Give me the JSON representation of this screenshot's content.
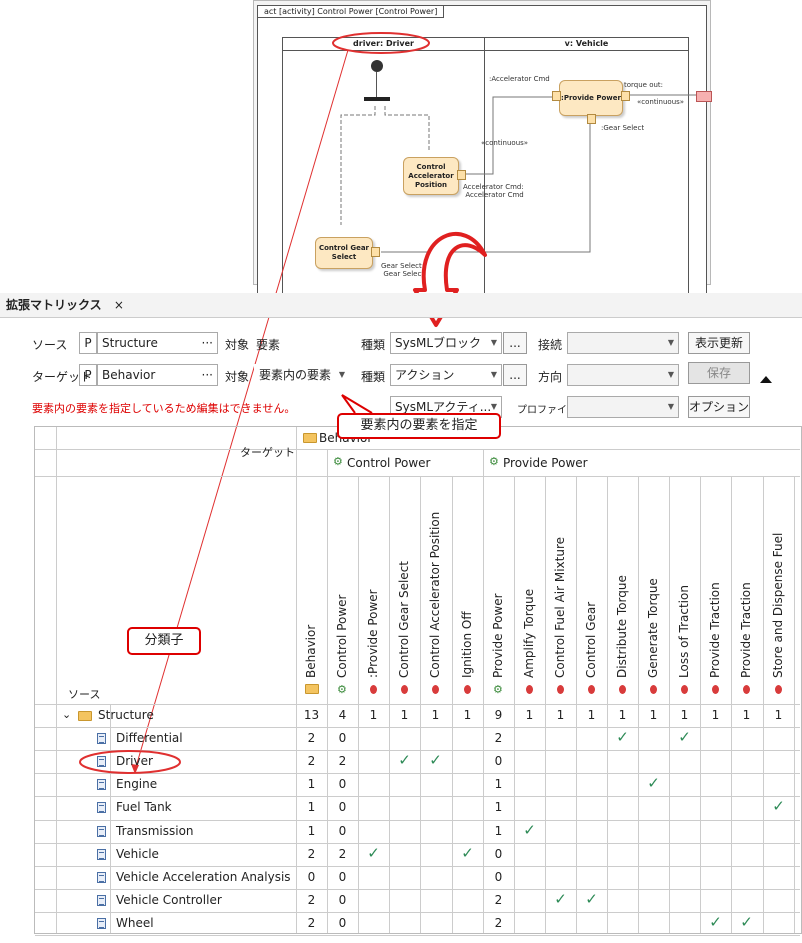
{
  "diagram": {
    "title": "act [activity] Control Power [Control Power]",
    "lane1": "driver: Driver",
    "lane2": "v: Vehicle",
    "actions": {
      "provide_power": ":Provide Power",
      "control_accel": "Control Accelerator Position",
      "control_gear": "Control Gear Select"
    },
    "labels": {
      "accel_cmd_top": ":Accelerator Cmd",
      "torque_out": "torque out:",
      "continuous1": "«continuous»",
      "continuous2": "«continuous»",
      "gear_select": ":Gear Select",
      "accel_cmd_pair": "Accelerator Cmd:\nAccelerator Cmd",
      "gear_select_pair": "Gear Select:\nGear Select"
    }
  },
  "tab": {
    "title": "拡張マトリックス",
    "close": "×"
  },
  "toolbar": {
    "source_label": "ソース",
    "source_p": "P",
    "source_value": "Structure",
    "source_dots": "···",
    "source_target_label": "対象",
    "source_target_value": "要素",
    "source_kind_label": "種類",
    "source_kind_value": "SysMLブロック",
    "source_kind_more": "...",
    "connect_label": "接続",
    "connect_value": "",
    "refresh_button": "表示更新",
    "target_label": "ターゲット",
    "target_p": "P",
    "target_value": "Behavior",
    "target_dots": "···",
    "target_target_label": "対象",
    "target_target_value": "要素内の要素",
    "target_kind_label": "種類",
    "target_kind_value": "アクション",
    "target_kind_more": "...",
    "direction_label": "方向",
    "direction_value": "",
    "save_button": "保存",
    "warning": "要素内の要素を指定しているため編集はできません。",
    "kind2_value": "SysMLアクティ...",
    "profile_label": "プロファイル",
    "profile_value": "",
    "options_button": "オプション"
  },
  "callouts": {
    "specify_inner": "要素内の要素を指定",
    "classifier": "分類子"
  },
  "matrix": {
    "target_header": "ターゲット",
    "source_header": "ソース",
    "behavior_group": "Behavior",
    "groups": [
      "Control Power",
      "Provide Power"
    ],
    "columns": [
      "Behavior",
      "Control Power",
      ":Provide Power",
      "Control  Gear Select",
      "Control Accelerator Position",
      "Ignition Off",
      "Provide Power",
      "Amplify Torque",
      "Control Fuel Air Mixture",
      "Control Gear",
      "Distribute Torque",
      "Generate Torque",
      "Loss of Traction",
      "Provide Traction",
      "Provide Traction",
      "Store and Dispense Fuel"
    ],
    "column_icons": [
      "folder",
      "activity",
      "action",
      "action",
      "action",
      "action",
      "activity",
      "action",
      "action",
      "action",
      "action",
      "action",
      "action",
      "action",
      "action",
      "action"
    ],
    "rows": [
      {
        "label": "Structure",
        "icon": "folder",
        "expanded": "⌄",
        "cells": [
          "13",
          "4",
          "1",
          "1",
          "1",
          "1",
          "9",
          "1",
          "1",
          "1",
          "1",
          "1",
          "1",
          "1",
          "1",
          "1"
        ]
      },
      {
        "label": "Differential",
        "icon": "block",
        "cells": [
          "2",
          "0",
          "",
          "",
          "",
          "",
          "2",
          "",
          "",
          "",
          "✓",
          "",
          "✓",
          "",
          "",
          ""
        ]
      },
      {
        "label": "Driver",
        "icon": "block",
        "cells": [
          "2",
          "2",
          "",
          "✓",
          "✓",
          "",
          "0",
          "",
          "",
          "",
          "",
          "",
          "",
          "",
          "",
          ""
        ]
      },
      {
        "label": "Engine",
        "icon": "block",
        "cells": [
          "1",
          "0",
          "",
          "",
          "",
          "",
          "1",
          "",
          "",
          "",
          "",
          "✓",
          "",
          "",
          "",
          ""
        ]
      },
      {
        "label": "Fuel Tank",
        "icon": "block",
        "cells": [
          "1",
          "0",
          "",
          "",
          "",
          "",
          "1",
          "",
          "",
          "",
          "",
          "",
          "",
          "",
          "",
          "✓"
        ]
      },
      {
        "label": "Transmission",
        "icon": "block",
        "cells": [
          "1",
          "0",
          "",
          "",
          "",
          "",
          "1",
          "✓",
          "",
          "",
          "",
          "",
          "",
          "",
          "",
          ""
        ]
      },
      {
        "label": "Vehicle",
        "icon": "block",
        "cells": [
          "2",
          "2",
          "✓",
          "",
          "",
          "✓",
          "0",
          "",
          "",
          "",
          "",
          "",
          "",
          "",
          "",
          ""
        ]
      },
      {
        "label": "Vehicle Acceleration Analysis",
        "icon": "block",
        "cells": [
          "0",
          "0",
          "",
          "",
          "",
          "",
          "0",
          "",
          "",
          "",
          "",
          "",
          "",
          "",
          "",
          ""
        ]
      },
      {
        "label": "Vehicle Controller",
        "icon": "block",
        "cells": [
          "2",
          "0",
          "",
          "",
          "",
          "",
          "2",
          "",
          "✓",
          "✓",
          "",
          "",
          "",
          "",
          "",
          ""
        ]
      },
      {
        "label": "Wheel",
        "icon": "block",
        "cells": [
          "2",
          "0",
          "",
          "",
          "",
          "",
          "2",
          "",
          "",
          "",
          "",
          "",
          "",
          "✓",
          "✓",
          ""
        ]
      }
    ]
  },
  "colors": {
    "accent_red": "#dd0000",
    "check_green": "#2e8b57"
  }
}
